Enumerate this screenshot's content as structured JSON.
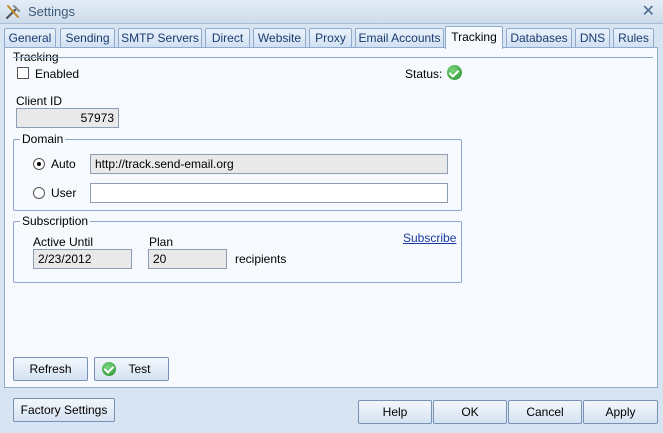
{
  "window": {
    "title": "Settings",
    "close_label": "✕"
  },
  "tabs": [
    {
      "label": "General"
    },
    {
      "label": "Sending"
    },
    {
      "label": "SMTP Servers"
    },
    {
      "label": "Direct"
    },
    {
      "label": "Website"
    },
    {
      "label": "Proxy"
    },
    {
      "label": "Email Accounts"
    },
    {
      "label": "Tracking",
      "active": true
    },
    {
      "label": "Databases"
    },
    {
      "label": "DNS"
    },
    {
      "label": "Rules"
    }
  ],
  "tracking": {
    "group_label": "Tracking",
    "enabled_label": "Enabled",
    "enabled_checked": false,
    "status_label": "Status:",
    "client_id_label": "Client ID",
    "client_id_value": "57973"
  },
  "domain": {
    "group_label": "Domain",
    "auto_label": "Auto",
    "auto_selected": true,
    "auto_value": "http://track.send-email.org",
    "user_label": "User",
    "user_value": ""
  },
  "subscription": {
    "group_label": "Subscription",
    "subscribe_link": "Subscribe",
    "active_until_label": "Active Until",
    "active_until_value": "2/23/2012",
    "plan_label": "Plan",
    "plan_value": "20",
    "plan_unit": "recipients"
  },
  "actions": {
    "refresh_label": "Refresh",
    "test_label": "Test"
  },
  "footer": {
    "factory_settings_label": "Factory Settings",
    "help_label": "Help",
    "ok_label": "OK",
    "cancel_label": "Cancel",
    "apply_label": "Apply"
  }
}
